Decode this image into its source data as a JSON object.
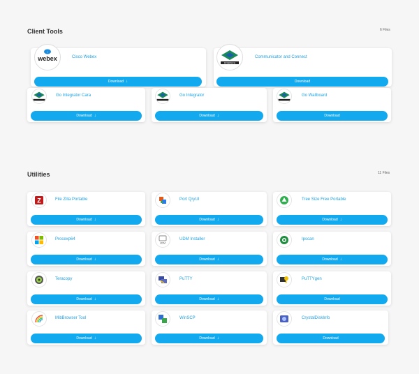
{
  "client_tools": {
    "title": "Client Tools",
    "count": "6 Files",
    "items": [
      {
        "name": "Cisco Webex",
        "icon": "webex-icon",
        "download": "Download"
      },
      {
        "name": "Communicator and Connect",
        "icon": "dobosch-icon",
        "download": "Download"
      },
      {
        "name": "Go Integrator Cara",
        "icon": "dobosch-icon",
        "download": "Download"
      },
      {
        "name": "Go Integrator",
        "icon": "dobosch-icon",
        "download": "Download"
      },
      {
        "name": "Go Wallboard",
        "icon": "dobosch-icon",
        "download": "Download"
      }
    ]
  },
  "utilities": {
    "title": "Utilities",
    "count": "11 Files",
    "items": [
      {
        "name": "File Zilla Portable",
        "icon": "filezilla-icon",
        "download": "Download"
      },
      {
        "name": "Port QryUI",
        "icon": "portqry-icon",
        "download": "Download"
      },
      {
        "name": "Tree Size Free Portable",
        "icon": "treesize-icon",
        "download": "Download"
      },
      {
        "name": "Procexp64",
        "icon": "procexp-icon",
        "download": "Download"
      },
      {
        "name": "UDM Installer",
        "icon": "udm-icon",
        "download": "Download"
      },
      {
        "name": "Ipscan",
        "icon": "ipscan-icon",
        "download": "Download"
      },
      {
        "name": "Teracopy",
        "icon": "teracopy-icon",
        "download": "Download"
      },
      {
        "name": "PuTTY",
        "icon": "putty-icon",
        "download": "Download"
      },
      {
        "name": "PuTTYgen",
        "icon": "puttygen-icon",
        "download": "Download"
      },
      {
        "name": "MibBrowser Tool",
        "icon": "mibbrowser-icon",
        "download": "Download"
      },
      {
        "name": "WinSCP",
        "icon": "winscp-icon",
        "download": "Download"
      },
      {
        "name": "CrystalDiskInfo",
        "icon": "crystaldiskinfo-icon",
        "download": "Download"
      }
    ]
  },
  "colors": {
    "accent": "#12a9ee",
    "link": "#1fa0e0",
    "background": "#f6f6f6"
  }
}
